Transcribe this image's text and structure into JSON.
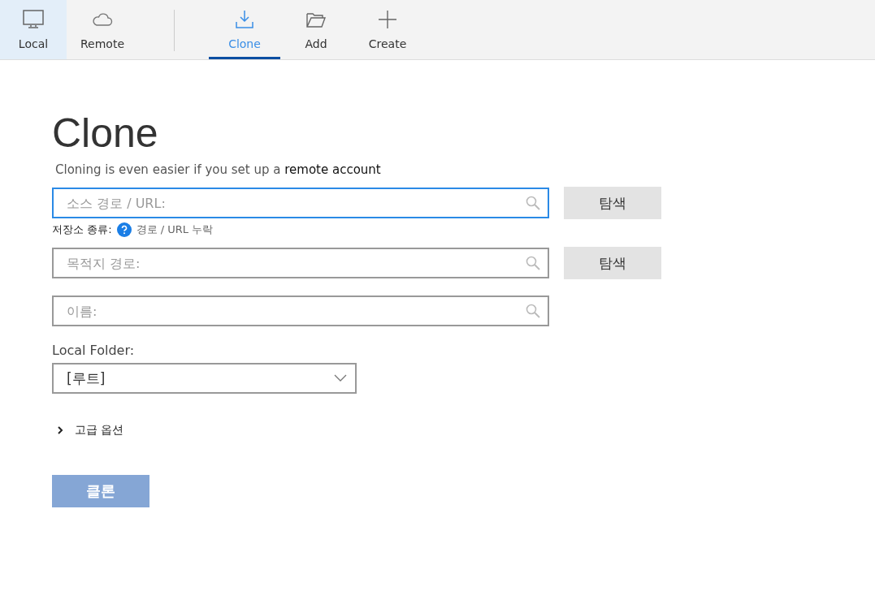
{
  "toolbar": {
    "locations": [
      {
        "label": "Local",
        "selected": true
      },
      {
        "label": "Remote",
        "selected": false
      }
    ],
    "actions": [
      {
        "label": "Clone",
        "selected": true
      },
      {
        "label": "Add",
        "selected": false
      },
      {
        "label": "Create",
        "selected": false
      }
    ]
  },
  "page": {
    "title": "Clone",
    "subtitle": {
      "text": "Cloning is even easier if you set up a ",
      "link": "remote account"
    },
    "fields": [
      {
        "placeholder": "소스 경로 / URL:",
        "focused": true,
        "browse": "탐색",
        "hint": {
          "label": "저장소 종류:",
          "text": "경로 / URL 누락"
        }
      },
      {
        "placeholder": "목적지 경로:",
        "focused": false,
        "browse": "탐색"
      },
      {
        "placeholder": "이름:",
        "focused": false
      }
    ],
    "folder": {
      "label": "Local Folder:",
      "value": "[루트]"
    },
    "advanced": {
      "label": "고급 옵션",
      "expanded": false
    },
    "submit": {
      "label": "클론",
      "disabled": true
    }
  }
}
